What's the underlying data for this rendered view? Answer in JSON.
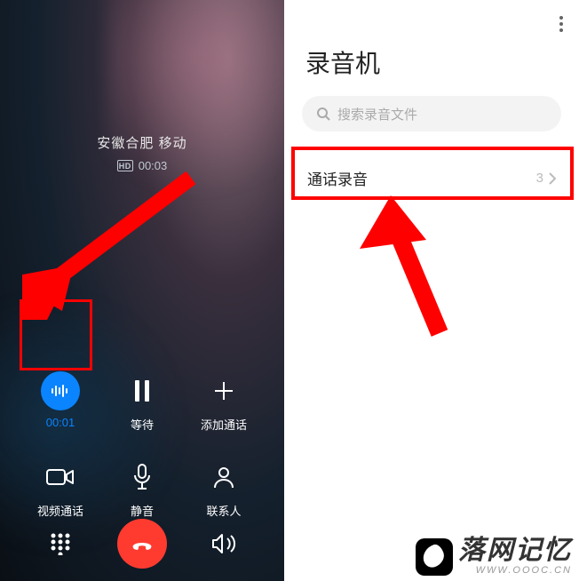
{
  "call": {
    "location": "安徽合肥 移动",
    "hd_badge": "HD",
    "duration": "00:03"
  },
  "controls": {
    "record": {
      "timer": "00:01"
    },
    "hold": {
      "label": "等待"
    },
    "add": {
      "label": "添加通话"
    },
    "video": {
      "label": "视频通话"
    },
    "mute": {
      "label": "静音"
    },
    "contacts": {
      "label": "联系人"
    }
  },
  "recorder": {
    "title": "录音机",
    "search_placeholder": "搜索录音文件",
    "item_label": "通话录音",
    "item_count": "3"
  },
  "watermark": {
    "main": "落网记忆",
    "sub": "WWW.OOOC.CN"
  }
}
